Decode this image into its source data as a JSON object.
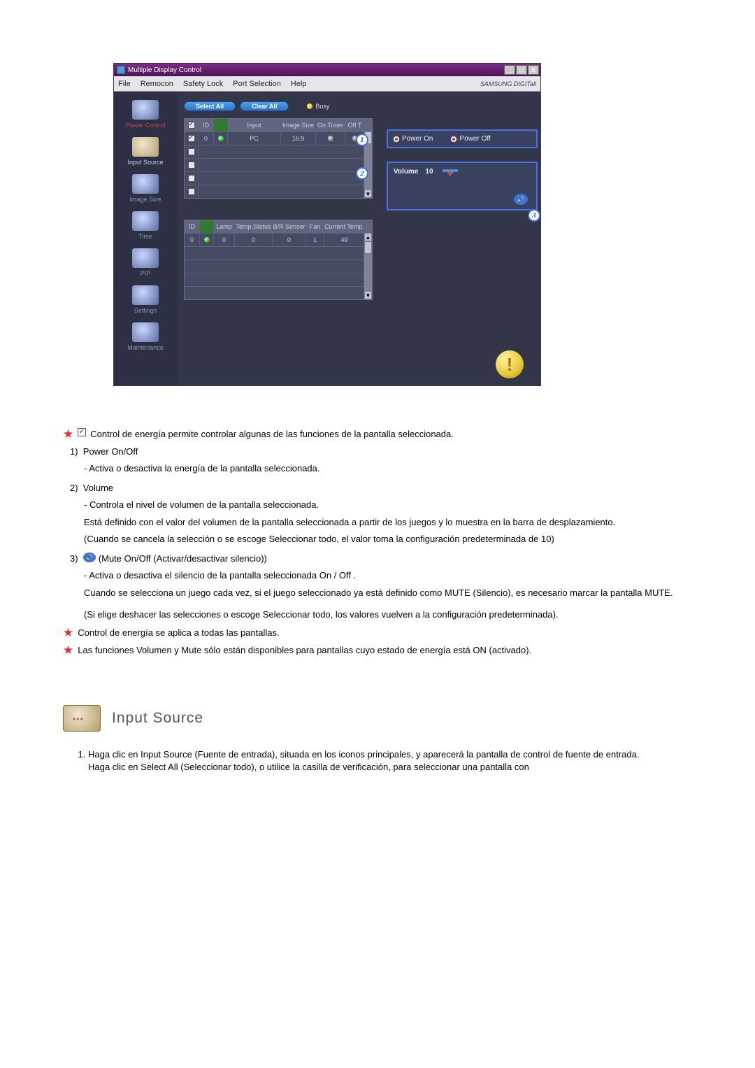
{
  "app": {
    "title": "Multiple Display Control",
    "window_buttons": {
      "min": "_",
      "max": "□",
      "close": "X"
    },
    "menu": [
      "File",
      "Remocon",
      "Safety Lock",
      "Port Selection",
      "Help"
    ],
    "brand": "SAMSUNG DIGITall",
    "sidebar": [
      {
        "label": "Power Control"
      },
      {
        "label": "Input Source"
      },
      {
        "label": "Image Size"
      },
      {
        "label": "Time"
      },
      {
        "label": "PIP"
      },
      {
        "label": "Settings"
      },
      {
        "label": "Maintenance"
      }
    ],
    "toolbar": {
      "select_all": "Select All",
      "clear_all": "Clear All",
      "busy": "Busy"
    },
    "grid1": {
      "headers": [
        "",
        "ID",
        "",
        "Input",
        "Image Size",
        "On Timer",
        "Off T"
      ],
      "rows": [
        {
          "checked": true,
          "id": "0",
          "power": "green",
          "input": "PC",
          "size": "16:9",
          "onTimer": "○",
          "offTimer": "○"
        },
        {
          "checked": false
        },
        {
          "checked": false
        },
        {
          "checked": false
        },
        {
          "checked": false
        }
      ]
    },
    "grid2": {
      "headers": [
        "ID",
        "",
        "Lamp",
        "Temp.Status",
        "B/R Senser",
        "Fan",
        "Current Temp."
      ],
      "rows": [
        {
          "id": "0",
          "power": "green",
          "lamp": "0",
          "temp": "0",
          "br": "0",
          "fan": "1",
          "cur": "49"
        },
        {},
        {},
        {},
        {}
      ]
    },
    "panel_power": {
      "on": "Power On",
      "off": "Power Off"
    },
    "panel_volume": {
      "label": "Volume",
      "value": "10"
    },
    "callouts": {
      "1": "1",
      "2": "2",
      "3": "3"
    }
  },
  "doc": {
    "intro_check": "Control de energía permite controlar algunas de las funciones de la pantalla seleccionada.",
    "item1_title": "Power On/Off",
    "item1_line": "- Activa o desactiva la energía de la pantalla seleccionada.",
    "item2_title": "Volume",
    "item2_l1": "- Controla el nivel de volumen de la pantalla seleccionada.",
    "item2_l2": "Está definido con el valor del volumen de la pantalla seleccionada a partir de los juegos y lo muestra en la barra de desplazamiento.",
    "item2_l3": "(Cuando se cancela la selección o se escoge Seleccionar todo, el valor toma la configuración predeterminada de 10)",
    "item3_title": "(Mute On/Off (Activar/desactivar silencio))",
    "item3_l1": "- Activa o desactiva el silencio de la pantalla seleccionada On / Off .",
    "item3_l2": "Cuando se selecciona un juego cada vez, si el juego seleccionado ya está definido como MUTE (Silencio), es necesario marcar la pantalla MUTE.",
    "item3_l3": "(Si elige deshacer las selecciones o escoge Seleccionar todo, los valores vuelven a la configuración predeterminada).",
    "note1": "Control de energía se aplica a todas las pantallas.",
    "note2": "Las funciones Volumen y Mute sólo están disponibles para pantallas cuyo estado de energía está ON (activado).",
    "section_title": "Input Source",
    "ol1a": "Haga clic en Input Source (Fuente de entrada), situada en los iconos principales, y aparecerá la pantalla de control de fuente de entrada.",
    "ol1b": "Haga clic en Select All (Seleccionar todo), o utilice la casilla de verificación, para seleccionar una pantalla con"
  }
}
